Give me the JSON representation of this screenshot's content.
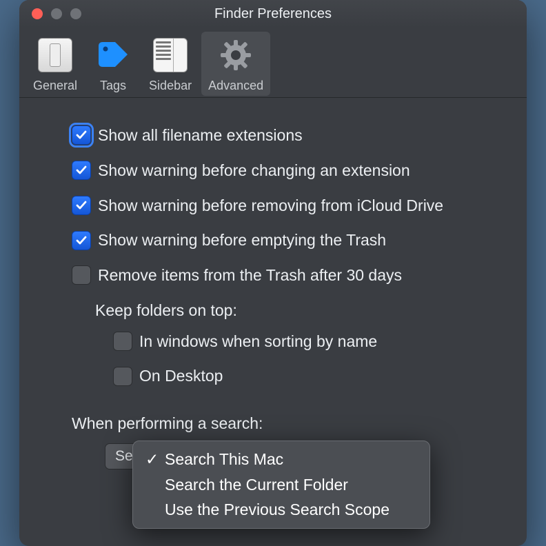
{
  "window": {
    "title": "Finder Preferences"
  },
  "toolbar": {
    "general": "General",
    "tags": "Tags",
    "sidebar": "Sidebar",
    "advanced": "Advanced"
  },
  "prefs": {
    "show_ext": "Show all filename extensions",
    "warn_ext": "Show warning before changing an extension",
    "warn_icloud": "Show warning before removing from iCloud Drive",
    "warn_trash": "Show warning before emptying the Trash",
    "remove_30": "Remove items from the Trash after 30 days",
    "keep_top_label": "Keep folders on top:",
    "keep_top_windows": "In windows when sorting by name",
    "keep_top_desktop": "On Desktop",
    "search_label": "When performing a search:"
  },
  "search_menu": {
    "selected": "Search This Mac",
    "opt1": "Search This Mac",
    "opt2": "Search the Current Folder",
    "opt3": "Use the Previous Search Scope"
  }
}
